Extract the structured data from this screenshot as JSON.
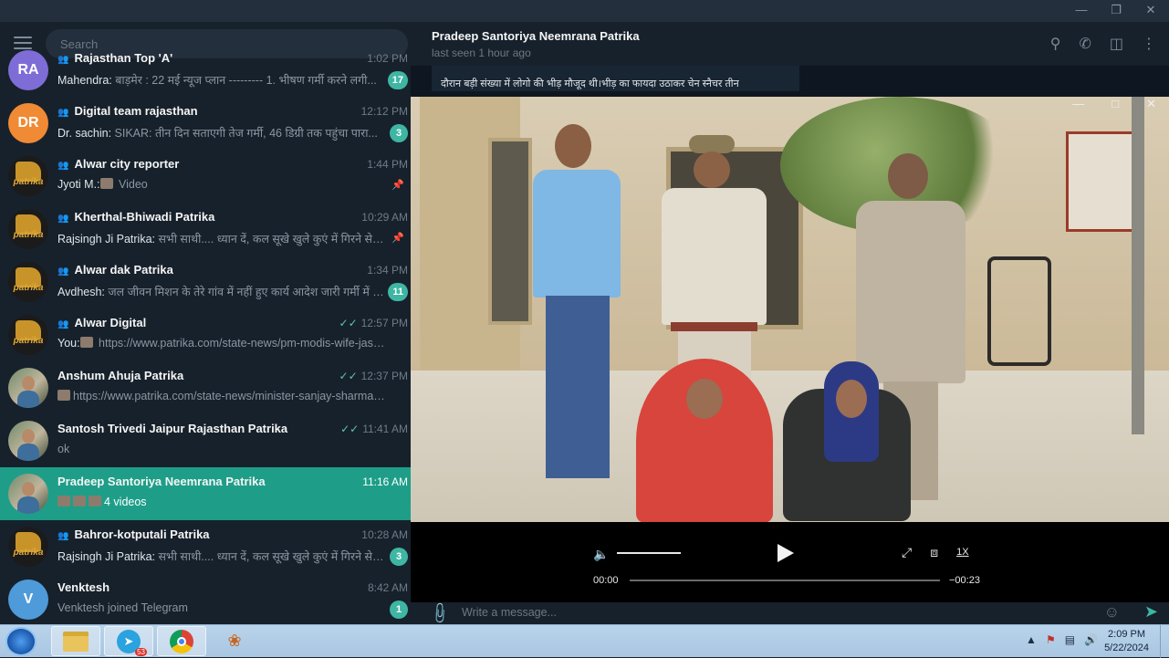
{
  "window": {
    "controls": [
      "—",
      "❐",
      "✕"
    ]
  },
  "search": {
    "placeholder": "Search"
  },
  "chats": [
    {
      "name": "Rajasthan Top 'A'",
      "time": "1:02 PM",
      "sender": "Mahendra:",
      "preview": " बाड़मेर : 22 मई न्यूज प्लान --------- 1. भीषण गर्मी करने लगी...",
      "badge": "17",
      "avatar": "RA",
      "avatar_color": "#7e6dd6",
      "group": true
    },
    {
      "name": "Digital team rajasthan",
      "time": "12:12 PM",
      "sender": "Dr. sachin:",
      "preview": " SIKAR: तीन दिन सताएगी तेज गर्मी, 46 डिग्री तक पहुंचा पारा...",
      "badge": "3",
      "avatar": "DR",
      "avatar_color": "#f08a35",
      "group": true
    },
    {
      "name": "Alwar city reporter",
      "time": "1:44 PM",
      "sender": "Jyoti M.:",
      "preview": " Video",
      "badge": "",
      "avatar_style": "patrika",
      "group": true,
      "pinned": true
    },
    {
      "name": "Kherthal-Bhiwadi Patrika",
      "time": "10:29 AM",
      "sender": "Rajsingh Ji Patrika:",
      "preview": " सभी साथी.... ध्यान दें, कल सूखे खुले कुएं में गिरने से एक ...",
      "badge": "",
      "avatar_style": "patrika",
      "group": true,
      "pinned": true
    },
    {
      "name": "Alwar dak Patrika",
      "time": "1:34 PM",
      "sender": "Avdhesh:",
      "preview": " जल जीवन मिशन के तेरे गांव में नहीं हुए कार्य आदेश जारी गर्मी में र...",
      "badge": "11",
      "avatar_style": "patrika",
      "group": true
    },
    {
      "name": "Alwar Digital",
      "time": "12:57 PM",
      "sender": "You:",
      "preview": " https://www.patrika.com/state-news/pm-modis-wife-jasho...",
      "badge": "",
      "avatar_style": "patrika",
      "group": true,
      "read": true
    },
    {
      "name": "Anshum Ahuja Patrika",
      "time": "12:37 PM",
      "sender": "",
      "preview": "https://www.patrika.com/state-news/minister-sanjay-sharma-s...",
      "badge": "",
      "avatar_style": "photo",
      "group": false,
      "read": true
    },
    {
      "name": "Santosh Trivedi Jaipur Rajasthan Patrika",
      "time": "11:41 AM",
      "sender": "",
      "preview": "ok",
      "badge": "",
      "avatar_style": "photo",
      "group": false,
      "read": true
    },
    {
      "name": "Pradeep Santoriya Neemrana Patrika",
      "time": "11:16 AM",
      "sender": "",
      "preview": "4 videos",
      "badge": "",
      "avatar_style": "photo",
      "group": false,
      "active": true
    },
    {
      "name": "Bahror-kotputali Patrika",
      "time": "10:28 AM",
      "sender": "Rajsingh Ji Patrika:",
      "preview": " सभी साथी.... ध्यान दें, कल सूखे खुले कुएं में गिरने से एक ...",
      "badge": "3",
      "avatar_style": "patrika",
      "group": true
    },
    {
      "name": "Venktesh",
      "time": "8:42 AM",
      "sender": "",
      "preview": "Venktesh joined Telegram",
      "badge": "1",
      "avatar": "V",
      "avatar_color": "#4f9ad9",
      "group": false
    }
  ],
  "avatar_logo_text": "patrika",
  "chat_header": {
    "title": "Pradeep Santoriya Neemrana Patrika",
    "status": "last seen 1 hour ago"
  },
  "message_snippet": {
    "line1": "दौरान बड़ी संख्या में लोगो की भीड़ मौजूद थी।भीड़ का फायदा उठाकर चेन स्नैचर तीन"
  },
  "video_player": {
    "current_time": "00:00",
    "remaining_time": "−00:23",
    "speed": "1X"
  },
  "composer": {
    "placeholder": "Write a message..."
  },
  "taskbar": {
    "telegram_badge": "53",
    "time": "2:09 PM",
    "date": "5/22/2024"
  }
}
